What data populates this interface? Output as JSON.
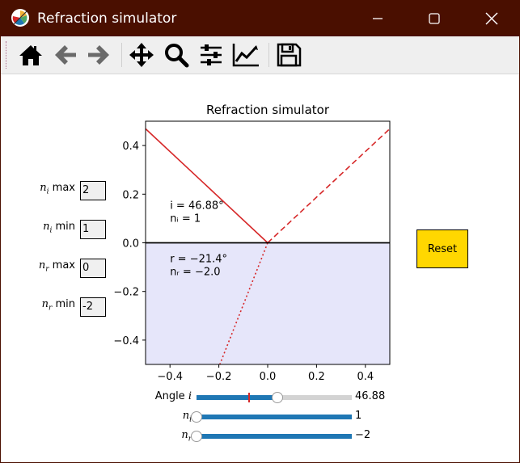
{
  "window": {
    "title": "Refraction simulator",
    "titlebar_color": "#4a0f00",
    "controls": [
      "minimize-icon",
      "maximize-icon",
      "close-icon"
    ]
  },
  "toolbar": {
    "buttons": [
      "home-icon",
      "back-icon",
      "forward-icon",
      "pan-icon",
      "zoom-icon",
      "configure-subplots-icon",
      "edit-axes-icon",
      "save-icon"
    ]
  },
  "text_boxes": [
    {
      "label_sym": "n",
      "label_sub": "i",
      "label_rest": " max",
      "value": "2"
    },
    {
      "label_sym": "n",
      "label_sub": "i",
      "label_rest": " min",
      "value": "1"
    },
    {
      "label_sym": "n",
      "label_sub": "r",
      "label_rest": " max",
      "value": "0"
    },
    {
      "label_sym": "n",
      "label_sub": "r",
      "label_rest": " min",
      "value": "-2"
    }
  ],
  "reset_label": "Reset",
  "sliders": [
    {
      "label_word": "Angle ",
      "label_sym": "i",
      "label_sub": "",
      "value_text": "46.88",
      "fraction": 0.521,
      "init_fraction": 0.333
    },
    {
      "label_word": "",
      "label_sym": "n",
      "label_sub": "i",
      "value_text": "1",
      "fraction": 0.0
    },
    {
      "label_word": "",
      "label_sym": "n",
      "label_sub": "r",
      "value_text": "−2",
      "fraction": 0.0
    }
  ],
  "chart_data": {
    "type": "line",
    "title": "Refraction simulator",
    "xlim": [
      -0.5,
      0.5
    ],
    "ylim": [
      -0.5,
      0.5
    ],
    "xticks": [
      -0.4,
      -0.2,
      0.0,
      0.2,
      0.4
    ],
    "yticks": [
      -0.4,
      -0.2,
      0.0,
      0.2,
      0.4
    ],
    "xtick_labels": [
      "−0.4",
      "−0.2",
      "0.0",
      "0.2",
      "0.4"
    ],
    "ytick_labels": [
      "−0.4",
      "−0.2",
      "0.0",
      "0.2",
      "0.4"
    ],
    "lower_region_color": "#e6e6fa",
    "ray_color": "#d62728",
    "rays": [
      {
        "role": "incident",
        "style": "solid",
        "points": [
          [
            -0.5,
            0.4689
          ],
          [
            0.0,
            0.0
          ]
        ]
      },
      {
        "role": "reflected",
        "style": "dashed",
        "points": [
          [
            0.0,
            0.0
          ],
          [
            0.5,
            0.4689
          ]
        ]
      },
      {
        "role": "refracted",
        "style": "dotted",
        "points": [
          [
            0.0,
            0.0
          ],
          [
            -0.196,
            -0.5
          ]
        ]
      }
    ],
    "interface": {
      "y": 0.0,
      "color": "#000000"
    },
    "annotations": [
      {
        "line1": "i = 46.88°",
        "line2": "nᵢ = 1",
        "x": -0.4,
        "y": 0.14
      },
      {
        "line1": "r = −21.4°",
        "line2": "nᵣ = −2.0",
        "x": -0.4,
        "y": -0.08
      }
    ]
  }
}
